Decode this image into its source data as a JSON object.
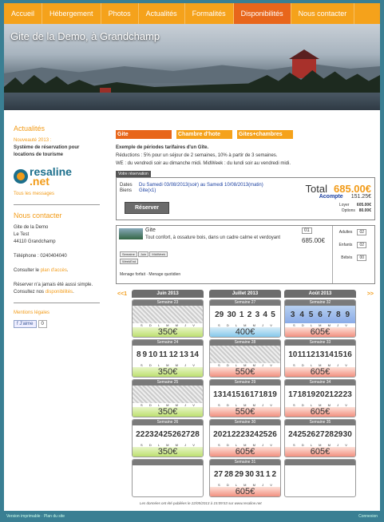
{
  "nav": [
    "Accueil",
    "Hébergement",
    "Photos",
    "Actualités",
    "Formalités",
    "Disponibilités",
    "Nous contacter"
  ],
  "nav_active": 5,
  "banner_title": "Gite de la Demo, à Grandchamp",
  "sidebar": {
    "news_title": "Actualités",
    "news_label": "Nouveauté 2013 :",
    "news_text": "Système de réservation pour locations de tourisme",
    "logo_text": "resaline",
    "logo_net": ".net",
    "all_messages": "Tous les messages",
    "contact_title": "Nous contacter",
    "contact_name": "Gite de la Demo",
    "contact_place": "Le Test",
    "contact_city": "44110 Grandchamp",
    "phone": "Téléphone : 0240404040",
    "map_prefix": "Consulter le",
    "map_link": "plan d'accès",
    "reserve_text": "Réserver n'a jamais été aussi simple. Consultez nos",
    "reserve_link": "disponibilités",
    "legal": "Mentions légales",
    "fb_label": "J'aime",
    "fb_count": "0"
  },
  "tabs": [
    "Gite",
    "Chambre d'hote",
    "Gites+chambres"
  ],
  "info": {
    "title": "Exemple de périodes tarifaires d'un Gîte.",
    "reductions": "Réductions : 5% pour un séjour de 2 semaines, 10% à partir de 3 semaines.",
    "we": "WE : du vendredi soir au dimanche midi. MidWeek : du lundi soir au vendredi midi."
  },
  "reservation": {
    "label": "Votre réservation",
    "dates_label": "Dates",
    "dates_value": "Du Samedi 03/08/2013(soir) au Samedi 10/08/2013(matin)",
    "biens_label": "Biens",
    "biens_value": "Gite(x1)",
    "total_label": "Total",
    "total_value": "685.00€",
    "acompte_label": "Acompte",
    "acompte_value": "151.25€",
    "loyer_label": "Loyer",
    "loyer_value": "605.00€",
    "options_label": "Options",
    "options_value": "80.00€",
    "button": "Réserver"
  },
  "gite": {
    "name": "Gite",
    "desc": "Tout confort, à ossature bois, dans un cadre calme et verdoyant",
    "qty": "01",
    "price": "685.00€",
    "adultes_label": "Adultes",
    "adultes": "02",
    "enfants_label": "Enfants",
    "enfants": "02",
    "bebes_label": "Bébés",
    "bebes": "00",
    "semaine": "Semaine",
    "juin": "Juin",
    "midweek": "MidWeek",
    "weekend": "WeekEnd",
    "menage_forfait": "Menage forfait",
    "menage_quotidien": "Menage quotidien"
  },
  "calendar": {
    "prev": "<<1",
    "next": ">>",
    "months": [
      "Juin 2013",
      "Juillet 2013",
      "Août 2013"
    ],
    "day_letters": [
      "S",
      "D",
      "L",
      "M",
      "M",
      "J",
      "V"
    ],
    "weeks": [
      [
        {
          "title": "Semaine 23",
          "days": [],
          "price": "350€",
          "style": "green",
          "hatched": true
        },
        {
          "title": "Semaine 24",
          "days": [
            "8",
            "9",
            "10",
            "11",
            "12",
            "13",
            "14"
          ],
          "price": "350€",
          "style": "green"
        },
        {
          "title": "Semaine 25",
          "days": [],
          "price": "350€",
          "style": "green",
          "hatched": true
        },
        {
          "title": "Semaine 26",
          "days": [
            "22",
            "23",
            "24",
            "25",
            "26",
            "27",
            "28"
          ],
          "price": "350€",
          "style": "green"
        },
        null
      ],
      [
        {
          "title": "Semaine 27",
          "days": [
            "29",
            "30",
            "1",
            "2",
            "3",
            "4",
            "5"
          ],
          "price": "400€",
          "style": "blue"
        },
        {
          "title": "Semaine 28",
          "days": [],
          "price": "550€",
          "style": "red",
          "hatched": true
        },
        {
          "title": "Semaine 29",
          "days": [
            "13",
            "14",
            "15",
            "16",
            "17",
            "18",
            "19"
          ],
          "price": "550€",
          "style": "red"
        },
        {
          "title": "Semaine 30",
          "days": [
            "20",
            "21",
            "22",
            "23",
            "24",
            "25",
            "26"
          ],
          "price": "605€",
          "style": "red"
        },
        {
          "title": "Semaine 31",
          "days": [
            "27",
            "28",
            "29",
            "30",
            "31",
            "1",
            "2"
          ],
          "price": "605€",
          "style": "red"
        }
      ],
      [
        {
          "title": "Semaine 32",
          "days": [
            "3",
            "4",
            "5",
            "6",
            "7",
            "8",
            "9"
          ],
          "price": "605€",
          "style": "red",
          "bluebar": true
        },
        {
          "title": "Semaine 33",
          "days": [
            "10",
            "11",
            "12",
            "13",
            "14",
            "15",
            "16"
          ],
          "price": "605€",
          "style": "red"
        },
        {
          "title": "Semaine 34",
          "days": [
            "17",
            "18",
            "19",
            "20",
            "21",
            "22",
            "23"
          ],
          "price": "605€",
          "style": "red"
        },
        {
          "title": "Semaine 35",
          "days": [
            "24",
            "25",
            "26",
            "27",
            "28",
            "29",
            "30"
          ],
          "price": "605€",
          "style": "red"
        },
        null
      ]
    ],
    "footnote": "Les données ont été publiées le 22/05/2013 à 15:09:53 sur www.resaline.net"
  },
  "footer": {
    "left": "Version imprimable · Plan du site",
    "right": "Connexion"
  }
}
